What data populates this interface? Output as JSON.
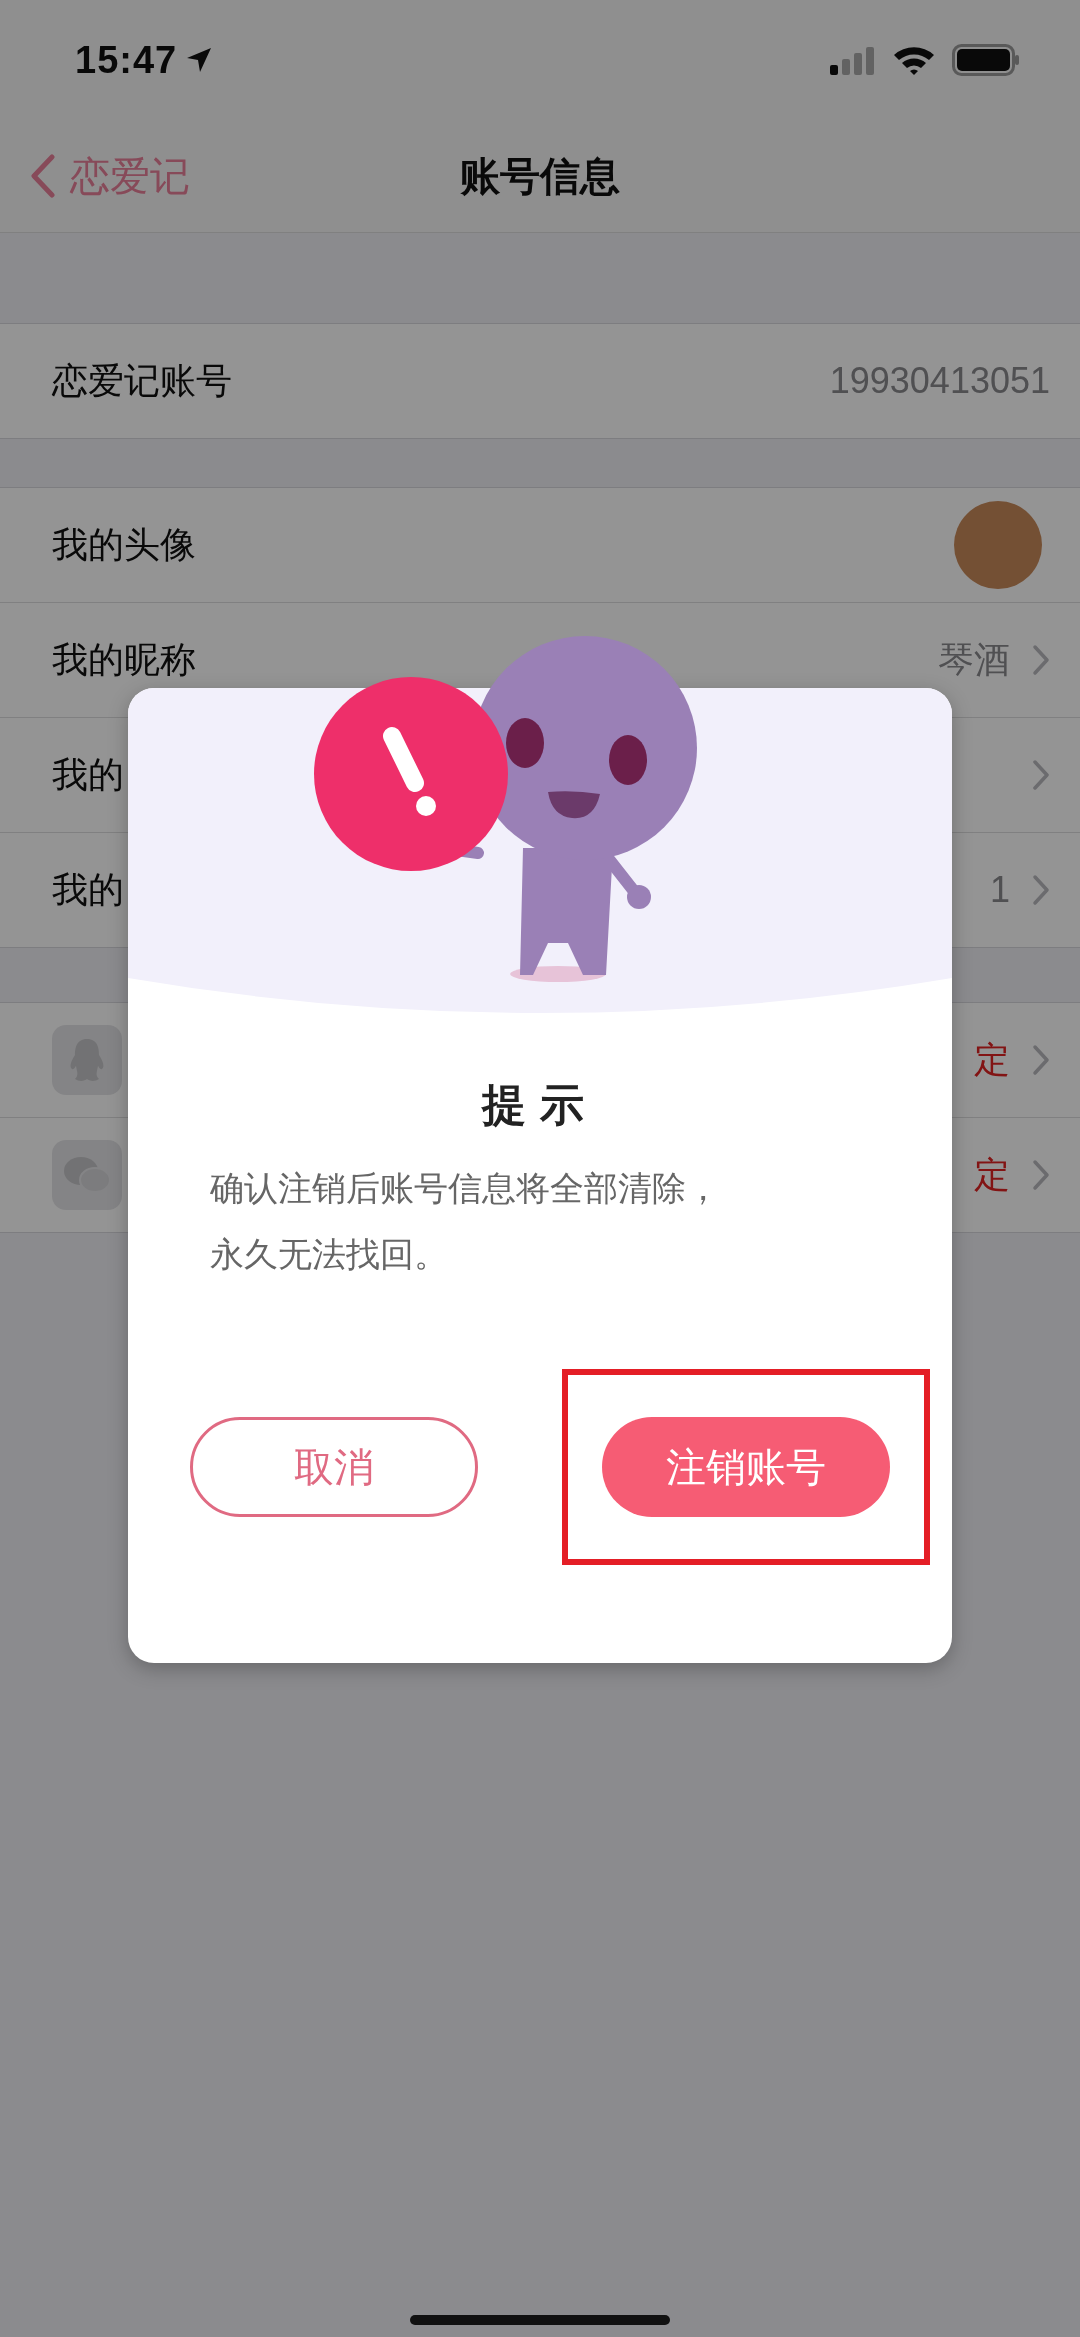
{
  "status_bar": {
    "time": "15:47"
  },
  "nav": {
    "back_label": "恋爱记",
    "title": "账号信息"
  },
  "account_row": {
    "label": "恋爱记账号",
    "value": "19930413051"
  },
  "profile_rows": [
    {
      "kind": "avatar",
      "label": "我的头像"
    },
    {
      "kind": "text",
      "label": "我的昵称",
      "value": "琴酒"
    },
    {
      "kind": "text",
      "label": "我的"
    },
    {
      "kind": "text",
      "label": "我的",
      "value": "1"
    }
  ],
  "bind_rows": [
    {
      "kind": "qq",
      "value": "定"
    },
    {
      "kind": "wechat",
      "value": "定"
    }
  ],
  "dialog": {
    "title": "提示",
    "message_lines": [
      "确认注销后账号信息将全部清除，",
      "永久无法找回。"
    ],
    "buttons": [
      {
        "kind": "secondary",
        "label": "取消",
        "highlighted": false
      },
      {
        "kind": "primary",
        "label": "注销账号",
        "highlighted": true
      }
    ]
  }
}
